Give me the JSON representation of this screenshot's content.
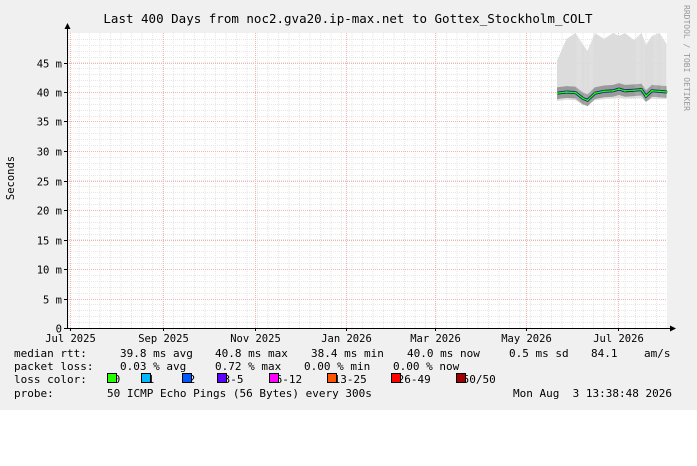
{
  "chart_data": {
    "type": "line",
    "title": "Last 400 Days from noc2.gva20.ip-max.net to Gottex_Stockholm_COLT",
    "ylabel": "Seconds",
    "side_label": "RRDTOOL / TOBI OETIKER",
    "y_ticks": [
      "0",
      "5 m",
      "10 m",
      "15 m",
      "20 m",
      "25 m",
      "30 m",
      "35 m",
      "40 m",
      "45 m"
    ],
    "y_tick_values": [
      0,
      0.005,
      0.01,
      0.015,
      0.02,
      0.025,
      0.03,
      0.035,
      0.04,
      0.045
    ],
    "ylim": [
      0,
      0.05
    ],
    "x_ticks": [
      "Jul 2025",
      "Sep 2025",
      "Nov 2025",
      "Jan 2026",
      "Mar 2026",
      "May 2026",
      "Jul 2026"
    ],
    "x_tick_dates": [
      "2025-07-01",
      "2025-09-01",
      "2025-11-01",
      "2026-01-01",
      "2026-03-01",
      "2026-05-01",
      "2026-07-01"
    ],
    "xlim": [
      "2025-06-29",
      "2026-08-03"
    ],
    "grid": true,
    "series": [
      {
        "name": "median rtt",
        "x": [
          "2026-05-22",
          "2026-05-28",
          "2026-06-03",
          "2026-06-08",
          "2026-06-11",
          "2026-06-16",
          "2026-06-22",
          "2026-06-28",
          "2026-07-02",
          "2026-07-06",
          "2026-07-12",
          "2026-07-17",
          "2026-07-20",
          "2026-07-24",
          "2026-07-29",
          "2026-08-03"
        ],
        "values": [
          0.0398,
          0.04,
          0.0399,
          0.0389,
          0.0386,
          0.0398,
          0.0401,
          0.0402,
          0.0405,
          0.0402,
          0.0403,
          0.0404,
          0.0393,
          0.0402,
          0.0401,
          0.04
        ],
        "smoke_max": [
          0.0455,
          0.049,
          0.05,
          0.048,
          0.047,
          0.05,
          0.049,
          0.05,
          0.0495,
          0.05,
          0.0488,
          0.05,
          0.048,
          0.0495,
          0.05,
          0.048
        ],
        "smoke_min": [
          0.0385,
          0.0387,
          0.0386,
          0.0378,
          0.038,
          0.0386,
          0.0388,
          0.0389,
          0.039,
          0.0389,
          0.0389,
          0.039,
          0.0384,
          0.0389,
          0.0388,
          0.0388
        ]
      }
    ],
    "loss_colors": [
      {
        "label": "0",
        "color": "#26ff00"
      },
      {
        "label": "1",
        "color": "#00b8ff"
      },
      {
        "label": "2",
        "color": "#0059ff"
      },
      {
        "label": "3-5",
        "color": "#5e00ff"
      },
      {
        "label": "6-12",
        "color": "#ff00ff"
      },
      {
        "label": "13-25",
        "color": "#ff5500"
      },
      {
        "label": "26-49",
        "color": "#ff0000"
      },
      {
        "label": "50/50",
        "color": "#a10000"
      }
    ]
  },
  "legend": {
    "rtt_label": "median rtt:",
    "rtt_avg": "39.8 ms avg",
    "rtt_max": "40.8 ms max",
    "rtt_min": "38.4 ms min",
    "rtt_now": "40.0 ms now",
    "rtt_sd": "0.5 ms sd",
    "rtt_ams": "84.1    am/s",
    "loss_label": "packet loss:",
    "loss_avg": "0.03 % avg",
    "loss_max": "0.72 % max",
    "loss_min": "0.00 % min",
    "loss_now": "0.00 % now",
    "color_label": "loss color:",
    "probe_label": "probe:",
    "probe_text": "50 ICMP Echo Pings (56 Bytes) every 300s",
    "timestamp": "Mon Aug  3 13:38:48 2026"
  }
}
